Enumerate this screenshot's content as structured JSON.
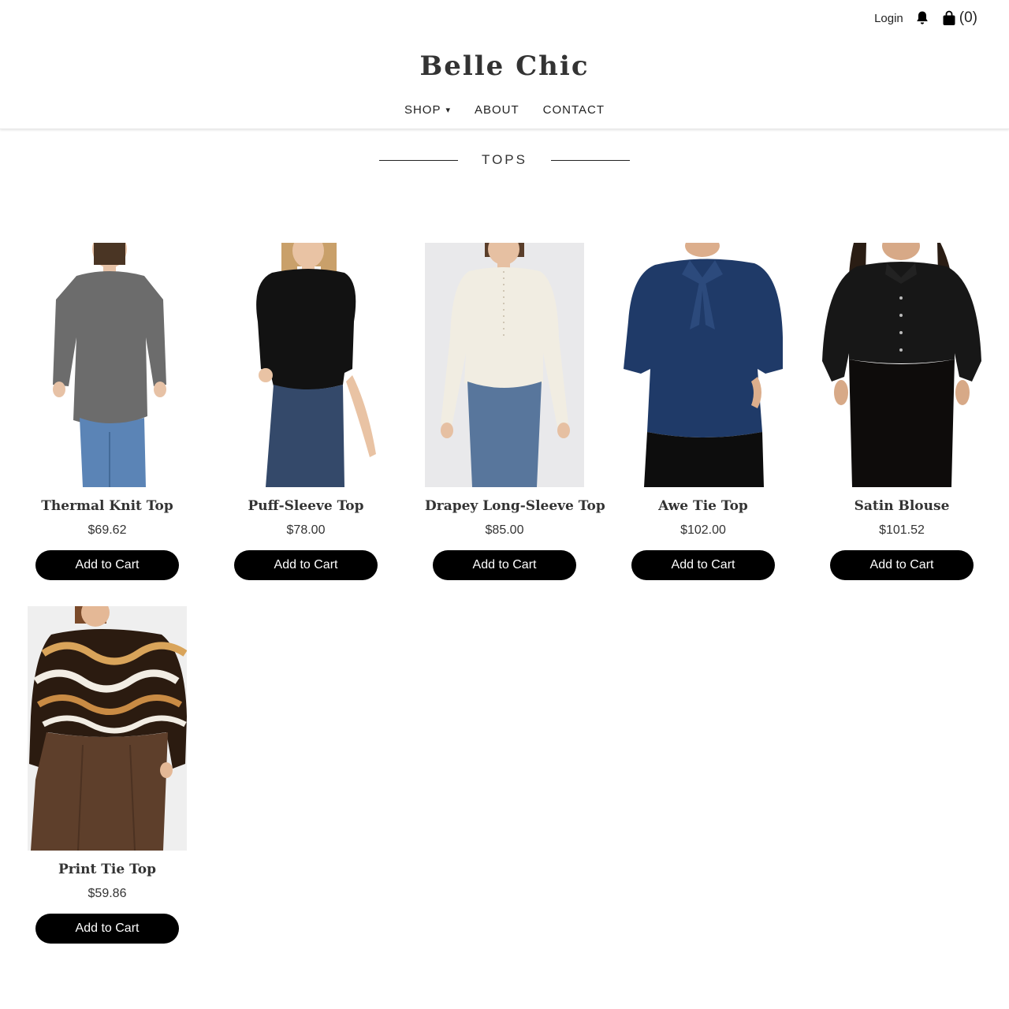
{
  "header": {
    "login_label": "Login",
    "cart_count": "(0)",
    "brand": "Belle Chic",
    "nav": [
      {
        "label": "SHOP",
        "caret": "▾"
      },
      {
        "label": "ABOUT"
      },
      {
        "label": "CONTACT"
      }
    ]
  },
  "section": {
    "title": "TOPS"
  },
  "products": [
    {
      "name": "Thermal Knit Top",
      "price": "$69.62",
      "button": "Add to Cart"
    },
    {
      "name": "Puff-Sleeve Top",
      "price": "$78.00",
      "button": "Add to Cart"
    },
    {
      "name": "Drapey Long-Sleeve Top",
      "price": "$85.00",
      "button": "Add to Cart"
    },
    {
      "name": "Awe Tie Top",
      "price": "$102.00",
      "button": "Add to Cart"
    },
    {
      "name": "Satin Blouse",
      "price": "$101.52",
      "button": "Add to Cart"
    },
    {
      "name": "Print Tie Top",
      "price": "$59.86",
      "button": "Add to Cart"
    }
  ],
  "colors": {
    "button_bg": "#000000",
    "button_text": "#ffffff",
    "text": "#333333"
  }
}
